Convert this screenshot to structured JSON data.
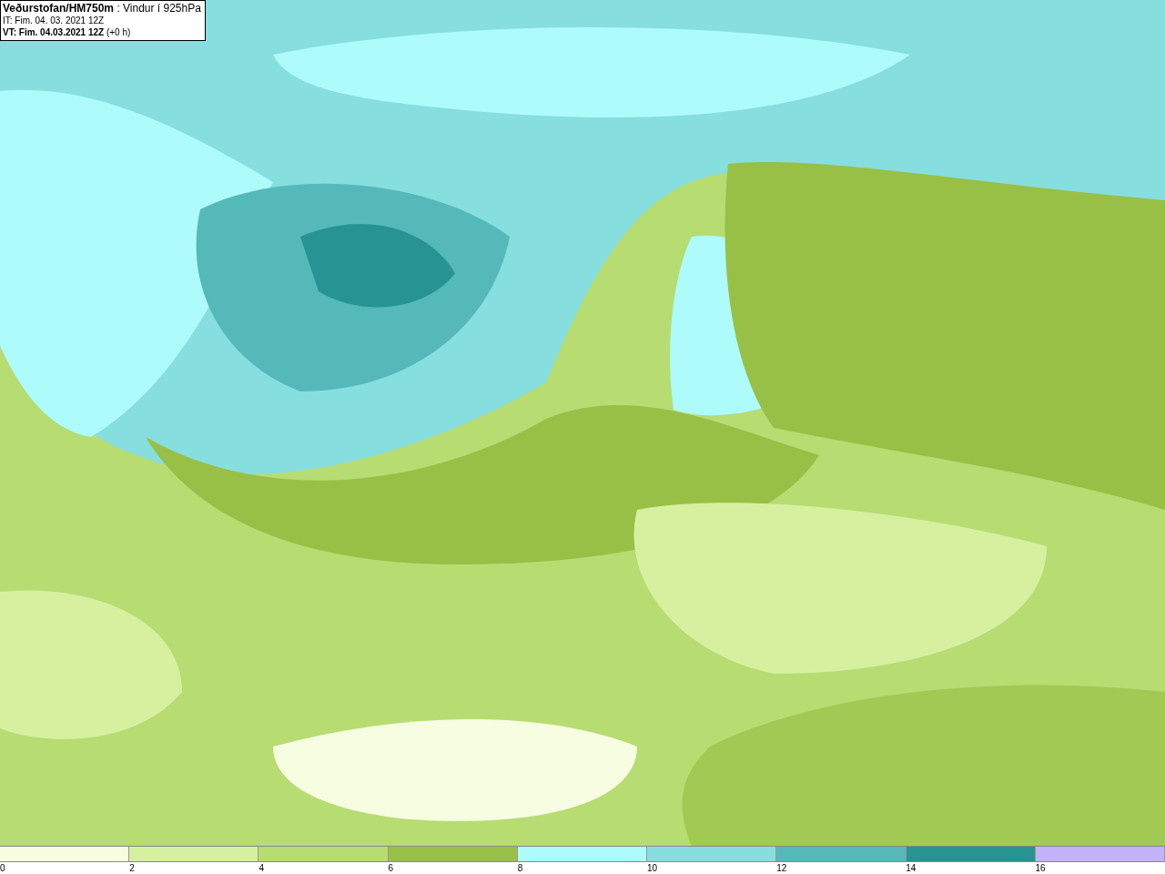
{
  "header": {
    "lines": [
      "**Veðurstofan/HM750m** : Vindur í 925hPa",
      "IT: Fim. 04. 03. 2021 12Z",
      "**VT: Fim. 04.03.2021 12Z** (+0 h)"
    ]
  },
  "legend": {
    "swatches": [
      {
        "color": "#f7fde0"
      },
      {
        "color": "#d6f0a0"
      },
      {
        "color": "#b7dc72"
      },
      {
        "color": "#98c046"
      },
      {
        "color": "#aefbfb"
      },
      {
        "color": "#86dede"
      },
      {
        "color": "#55b8b9"
      },
      {
        "color": "#279393"
      },
      {
        "color": "#c3b2f8"
      }
    ],
    "ticks": [
      "0",
      "2",
      "4",
      "6",
      "8",
      "10",
      "12",
      "14",
      "16"
    ]
  }
}
